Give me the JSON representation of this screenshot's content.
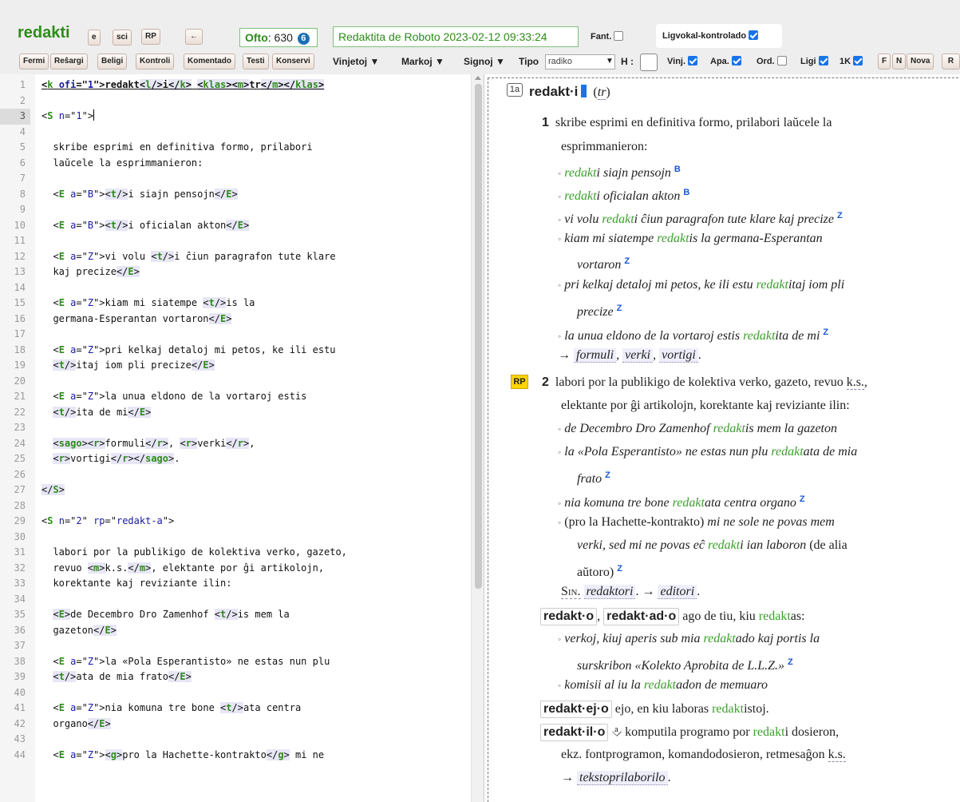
{
  "app": {
    "title": "redakti"
  },
  "toolbar_top": {
    "btn_e": "e",
    "btn_sci": "sci",
    "btn_rp": "RP",
    "btn_back": "←",
    "ofto_label": "Ofto",
    "ofto_value": ": 630",
    "ofto_badge": "6",
    "status": "Redaktita de Roboto 2023-02-12 09:33:24",
    "fant_label": "Fant.",
    "ligvokal_label": "Ligvokal-kontrolado"
  },
  "toolbar_bottom": {
    "buttons": [
      "Fermi",
      "Reŝargi",
      "Beligi",
      "Kontroli",
      "Komentado",
      "Testi",
      "Konservi"
    ],
    "menus": [
      "Vinjetoj ▼",
      "Markoj ▼",
      "Signoj ▼"
    ],
    "tipo_label": "Tipo",
    "tipo_value": "radiko",
    "tipo_arrow": "▼",
    "h_label": "H :",
    "opt_vinj": "Vinj.",
    "opt_apa": "Apa.",
    "opt_ord": "Ord.",
    "opt_ligi": "Ligi",
    "opt_1k": "1K",
    "btn_f": "F",
    "btn_n": "N",
    "btn_nova": "Nova",
    "btn_r": "R"
  },
  "editor": {
    "line_numbers": [
      "1",
      "2",
      "3",
      "4",
      "5",
      "6",
      "7",
      "8",
      "9",
      "10",
      "11",
      "12",
      "13",
      "14",
      "15",
      "16",
      "17",
      "18",
      "19",
      "20",
      "21",
      "22",
      "23",
      "24",
      "25",
      "26",
      "27",
      "28",
      "29",
      "30",
      "31",
      "32",
      "33",
      "34",
      "35",
      "36",
      "37",
      "38",
      "39",
      "40",
      "41",
      "42",
      "43",
      "44"
    ],
    "lines": {
      "l1": "<k ofi=\"1\">redakt<l/>i</k> <klas><m>tr</m></klas>",
      "l3": "<S n=\"1\">",
      "l5": "  skribe esprimi en definitiva formo, prilabori",
      "l6": "  laŭcele la esprimmanieron:",
      "l8": "  <E a=\"B\"><t/>i siajn pensojn</E>",
      "l10": "  <E a=\"B\"><t/>i oficialan akton</E>",
      "l12": "  <E a=\"Z\">vi volu <t/>i ĉiun paragrafon tute klare",
      "l13": "  kaj precize</E>",
      "l15": "  <E a=\"Z\">kiam mi siatempe <t/>is la",
      "l16": "  germana-Esperantan vortaron</E>",
      "l18": "  <E a=\"Z\">pri kelkaj detaloj mi petos, ke ili estu",
      "l19": "  <t/>itaj iom pli precize</E>",
      "l21": "  <E a=\"Z\">la unua eldono de la vortaroj estis",
      "l22": "  <t/>ita de mi</E>",
      "l24": "  <sago><r>formuli</r>, <r>verki</r>,",
      "l25": "  <r>vortigi</r></sago>.",
      "l27": "</S>",
      "l29": "<S n=\"2\" rp=\"redakt-a\">",
      "l31": "  labori por la publikigo de kolektiva verko, gazeto,",
      "l32": "  revuo <m>k.s.</m>, elektante por ĝi artikolojn,",
      "l33": "  korektante kaj reviziante ilin:",
      "l35": "  <E>de Decembro Dro Zamenhof <t/>is mem la",
      "l36": "  gazeton</E>",
      "l38": "  <E a=\"Z\">la «Pola Esperantisto» ne estas nun plu",
      "l39": "  <t/>ata de mia frato</E>",
      "l41": "  <E a=\"Z\">nia komuna tre bone <t/>ata centra",
      "l42": "  organo</E>",
      "l44": "  <E a=\"Z\"><g>pro la Hachette-kontrakto</g> mi ne"
    }
  },
  "preview": {
    "kap_tag": "1a",
    "kap_root": "redakt·i",
    "kap_klas": "tr",
    "s1_num": "1",
    "s1_def_a": "skribe esprimi en definitiva formo, prilabori laŭcele la",
    "s1_def_b": "esprimmanieron:",
    "ex1": {
      "pre": "",
      "hl": "redakt",
      "post": "i siajn pensojn",
      "src": "B"
    },
    "ex2": {
      "pre": "",
      "hl": "redakt",
      "post": "i oficialan akton",
      "src": "B"
    },
    "ex3": {
      "pre": "vi volu ",
      "hl": "redakt",
      "post": "i ĉiun paragrafon tute klare kaj precize",
      "src": "Z"
    },
    "ex4a": {
      "pre": "kiam mi siatempe ",
      "hl": "redakt",
      "post": "is la germana-Esperantan"
    },
    "ex4b": {
      "post": "vortaron",
      "src": "Z"
    },
    "ex5a": {
      "pre": "pri kelkaj detaloj mi petos, ke ili estu ",
      "hl": "redakt",
      "post": "itaj iom pli"
    },
    "ex5b": {
      "post": "precize",
      "src": "Z"
    },
    "ex6": {
      "pre": "la unua eldono de la vortaroj estis ",
      "hl": "redakt",
      "post": "ita de mi",
      "src": "Z"
    },
    "sago_arrow": "→",
    "sago_refs": [
      "formuli",
      "verki",
      "vortigi"
    ],
    "rp_badge": "RP",
    "s2_num": "2",
    "s2_def_a": "labori por la publikigo de kolektiva verko, gazeto, revuo ",
    "s2_ks": "k.s.",
    "s2_def_a_end": ",",
    "s2_def_b": "elektante por ĝi artikolojn, korektante kaj reviziante ilin:",
    "ex7": {
      "pre": "de Decembro Dro Zamenhof ",
      "hl": "redakt",
      "post": "is mem la gazeton"
    },
    "ex8a": {
      "pre": "la «Pola Esperantisto» ne estas nun plu ",
      "hl": "redakt",
      "post": "ata de mia"
    },
    "ex8b": {
      "post": "frato",
      "src": "Z"
    },
    "ex9": {
      "pre": "nia komuna tre bone ",
      "hl": "redakt",
      "post": "ata centra organo",
      "src": "Z"
    },
    "ex10a": {
      "paren": "(pro la Hachette-kontrakto)",
      "post": " mi ne sole ne povas mem"
    },
    "ex10b": {
      "pre": "verki, sed mi ne povas eĉ ",
      "hl": "redakt",
      "post": "i ian laboron",
      "paren": " (de alia"
    },
    "ex10c": {
      "post": "aŭtoro)",
      "src": "Z"
    },
    "sin_label": "Sin.",
    "sin_ref": "redaktori",
    "sin_arrow": "→",
    "sin_ref2": "editori",
    "drv1_a": "redakt·o",
    "drv1_b": "redakt·ad·o",
    "drv1_def_pre": " ago de tiu, kiu ",
    "drv1_def_hl": "redakt",
    "drv1_def_post": "as:",
    "ex11a": {
      "pre": "verkoj, kiuj aperis sub mia ",
      "hl": "redakt",
      "post": "ado kaj portis la"
    },
    "ex11b": {
      "post": "surskribon «Kolekto Aprobita de L.L.Z.»",
      "src": "Z"
    },
    "ex12": {
      "pre": "komisii al iu la ",
      "hl": "redakt",
      "post": "adon de memuaro"
    },
    "drv2": "redakt·ej·o",
    "drv2_def_pre": " ejo, en kiu laboras ",
    "drv2_def_hl": "redakt",
    "drv2_def_post": "istoj.",
    "drv3": "redakt·il·o",
    "drv3_icon": "⎀",
    "drv3_def_pre": " komputila programo por ",
    "drv3_def_hl": "redakt",
    "drv3_def_post": "i dosieron,",
    "drv3_def_b": "ekz. fontprogramon, komandodosieron, retmesaĝon ",
    "drv3_ks": "k.s.",
    "drv3_arrow": "→",
    "drv3_ref": "tekstoprilaborilo"
  }
}
